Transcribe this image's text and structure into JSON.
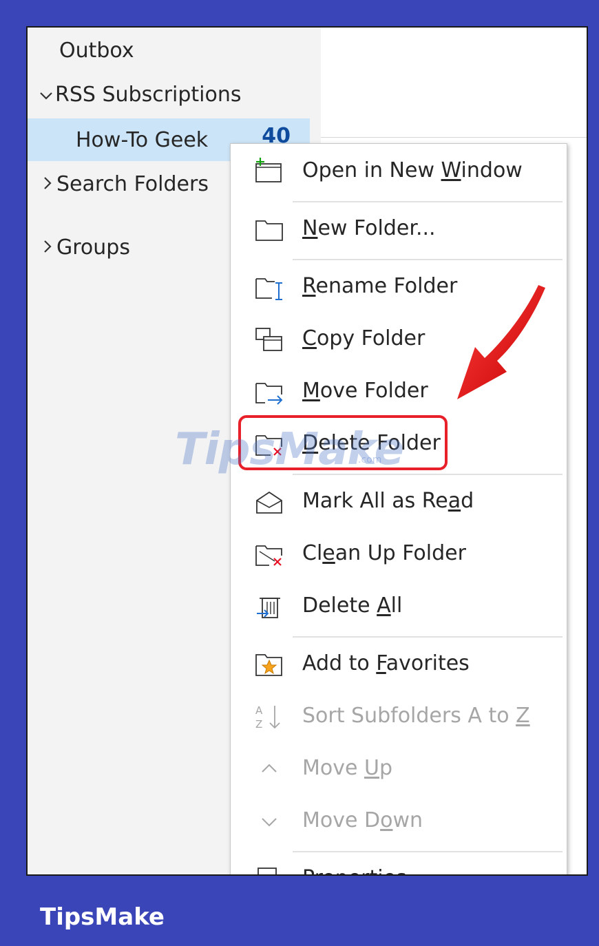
{
  "folder_tree": {
    "outbox": "Outbox",
    "rss_subscriptions": "RSS Subscriptions",
    "how_to_geek": "How-To Geek",
    "how_to_geek_count": "40",
    "search_folders": "Search Folders",
    "groups": "Groups"
  },
  "context_menu": {
    "items": [
      {
        "pre": "Open in New ",
        "key": "W",
        "post": "indow",
        "icon": "open-new-window-icon",
        "enabled": true
      },
      {
        "pre": "",
        "key": "N",
        "post": "ew Folder...",
        "icon": "new-folder-icon",
        "enabled": true
      },
      {
        "pre": "",
        "key": "R",
        "post": "ename Folder",
        "icon": "rename-folder-icon",
        "enabled": true
      },
      {
        "pre": "",
        "key": "C",
        "post": "opy Folder",
        "icon": "copy-folder-icon",
        "enabled": true
      },
      {
        "pre": "",
        "key": "M",
        "post": "ove Folder",
        "icon": "move-folder-icon",
        "enabled": true
      },
      {
        "pre": "",
        "key": "D",
        "post": "elete Folder",
        "icon": "delete-folder-icon",
        "enabled": true
      },
      {
        "pre": "Mark All as Re",
        "key": "a",
        "post": "d",
        "icon": "mark-all-read-icon",
        "enabled": true
      },
      {
        "pre": "Cl",
        "key": "e",
        "post": "an Up Folder",
        "icon": "clean-up-folder-icon",
        "enabled": true
      },
      {
        "pre": "Delete ",
        "key": "A",
        "post": "ll",
        "icon": "delete-all-icon",
        "enabled": true
      },
      {
        "pre": "Add to ",
        "key": "F",
        "post": "avorites",
        "icon": "add-to-favorites-icon",
        "enabled": true
      },
      {
        "pre": "Sort Subfolders A to ",
        "key": "Z",
        "post": "",
        "icon": "sort-az-icon",
        "enabled": false
      },
      {
        "pre": "Move ",
        "key": "U",
        "post": "p",
        "icon": "move-up-icon",
        "enabled": false
      },
      {
        "pre": "Move D",
        "key": "o",
        "post": "wn",
        "icon": "move-down-icon",
        "enabled": false
      },
      {
        "pre": "",
        "key": "P",
        "post": "roperties",
        "icon": "properties-icon",
        "enabled": true
      }
    ]
  },
  "watermark": {
    "text": "TipsMake",
    "suffix": ".com"
  },
  "footer": {
    "brand": "TipsMake"
  },
  "colors": {
    "frame_bg": "#3a45b8",
    "selected_bg": "#cce4f7",
    "highlight": "#e8202a",
    "disabled_text": "#a6a6a6"
  }
}
